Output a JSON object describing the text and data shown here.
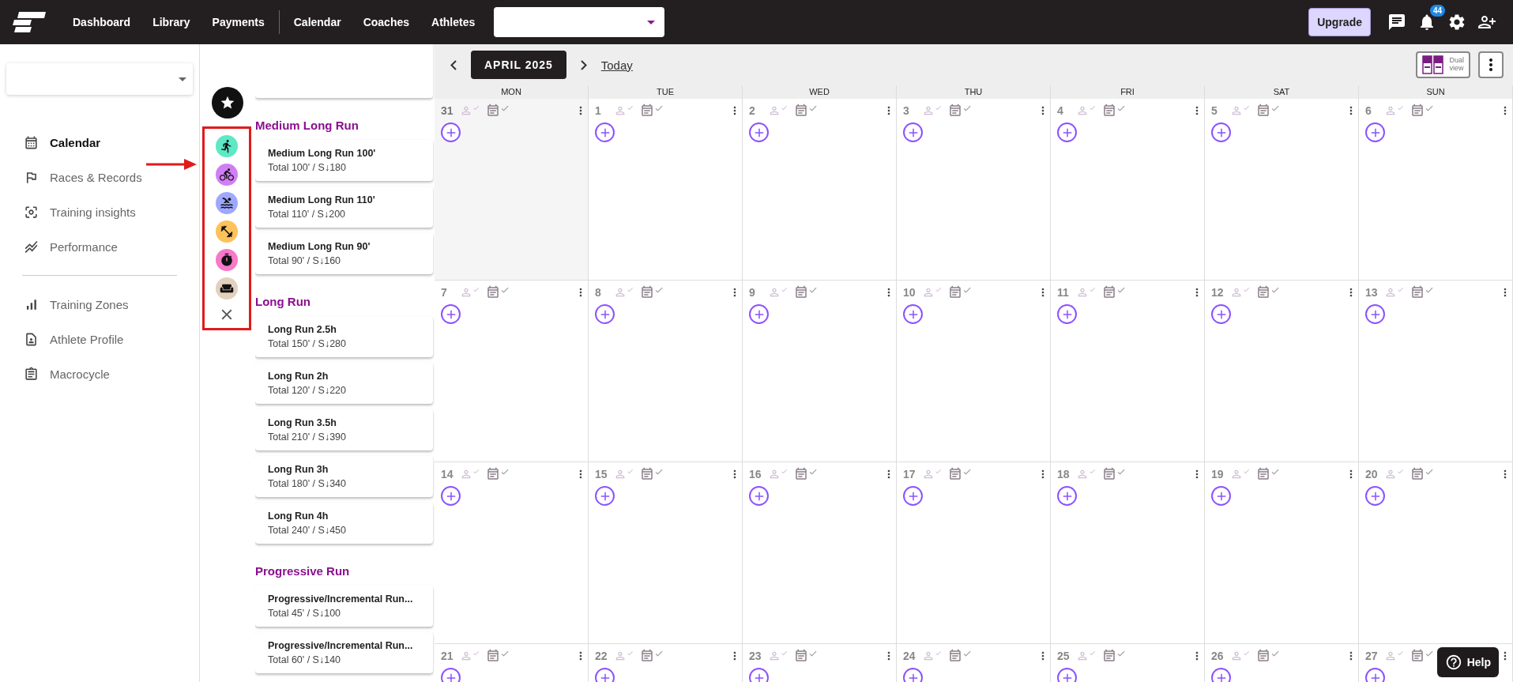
{
  "top_nav": {
    "items": [
      {
        "label": "Dashboard"
      },
      {
        "label": "Library"
      },
      {
        "label": "Payments"
      },
      {
        "label": "Calendar"
      },
      {
        "label": "Coaches"
      },
      {
        "label": "Athletes"
      }
    ],
    "upgrade": "Upgrade",
    "notifications": "44"
  },
  "sidebar": {
    "groups": [
      [
        {
          "label": "Calendar",
          "selected": true
        },
        {
          "label": "Races & Records",
          "selected": false
        },
        {
          "label": "Training insights",
          "selected": false
        },
        {
          "label": "Performance",
          "selected": false
        }
      ],
      [
        {
          "label": "Training Zones",
          "selected": false
        },
        {
          "label": "Athlete Profile",
          "selected": false
        },
        {
          "label": "Macrocycle",
          "selected": false
        }
      ]
    ]
  },
  "sport_filters": [
    {
      "kind": "run",
      "color": "#5ee8c5"
    },
    {
      "kind": "bike",
      "color": "#d17ef5"
    },
    {
      "kind": "swim",
      "color": "#9fa8ff"
    },
    {
      "kind": "strength",
      "color": "#fdc25a"
    },
    {
      "kind": "timer",
      "color": "#f779c8"
    },
    {
      "kind": "rest",
      "color": "#e3d0bd"
    },
    {
      "kind": "close"
    }
  ],
  "library": [
    {
      "title": "Medium Long Run",
      "items": [
        {
          "name": "Medium Long Run 100'",
          "detail": "Total 100' / S↓180"
        },
        {
          "name": "Medium Long Run 110'",
          "detail": "Total 110' / S↓200"
        },
        {
          "name": "Medium Long Run 90'",
          "detail": "Total 90' / S↓160"
        }
      ]
    },
    {
      "title": "Long Run",
      "items": [
        {
          "name": "Long Run 2.5h",
          "detail": "Total 150' / S↓280"
        },
        {
          "name": "Long Run 2h",
          "detail": "Total 120' / S↓220"
        },
        {
          "name": "Long Run 3.5h",
          "detail": "Total 210' / S↓390"
        },
        {
          "name": "Long Run 3h",
          "detail": "Total 180' / S↓340"
        },
        {
          "name": "Long Run 4h",
          "detail": "Total 240' / S↓450"
        }
      ]
    },
    {
      "title": "Progressive Run",
      "items": [
        {
          "name": "Progressive/Incremental Run...",
          "detail": "Total 45' / S↓100"
        },
        {
          "name": "Progressive/Incremental Run...",
          "detail": "Total 60' / S↓140"
        }
      ]
    }
  ],
  "calendar": {
    "month": "APRIL 2025",
    "today": "Today",
    "dual_view": [
      "Dual",
      "view"
    ],
    "weekdays": [
      "MON",
      "TUE",
      "WED",
      "THU",
      "FRI",
      "SAT",
      "SUN"
    ],
    "weeks": [
      [
        {
          "day": "31",
          "outside_month": true
        },
        {
          "day": "1",
          "outside_month": false
        },
        {
          "day": "2",
          "outside_month": false
        },
        {
          "day": "3",
          "outside_month": false
        },
        {
          "day": "4",
          "outside_month": false
        },
        {
          "day": "5",
          "outside_month": false
        },
        {
          "day": "6",
          "outside_month": false
        }
      ],
      [
        {
          "day": "7",
          "outside_month": false
        },
        {
          "day": "8",
          "outside_month": false
        },
        {
          "day": "9",
          "outside_month": false
        },
        {
          "day": "10",
          "outside_month": false
        },
        {
          "day": "11",
          "outside_month": false
        },
        {
          "day": "12",
          "outside_month": false
        },
        {
          "day": "13",
          "outside_month": false
        }
      ],
      [
        {
          "day": "14",
          "outside_month": false
        },
        {
          "day": "15",
          "outside_month": false
        },
        {
          "day": "16",
          "outside_month": false
        },
        {
          "day": "17",
          "outside_month": false
        },
        {
          "day": "18",
          "outside_month": false
        },
        {
          "day": "19",
          "outside_month": false
        },
        {
          "day": "20",
          "outside_month": false
        }
      ],
      [
        {
          "day": "21",
          "outside_month": false
        },
        {
          "day": "22",
          "outside_month": false
        },
        {
          "day": "23",
          "outside_month": false
        },
        {
          "day": "24",
          "outside_month": false
        },
        {
          "day": "25",
          "outside_month": false
        },
        {
          "day": "26",
          "outside_month": false
        },
        {
          "day": "27",
          "outside_month": false
        }
      ]
    ]
  },
  "help": "Help"
}
